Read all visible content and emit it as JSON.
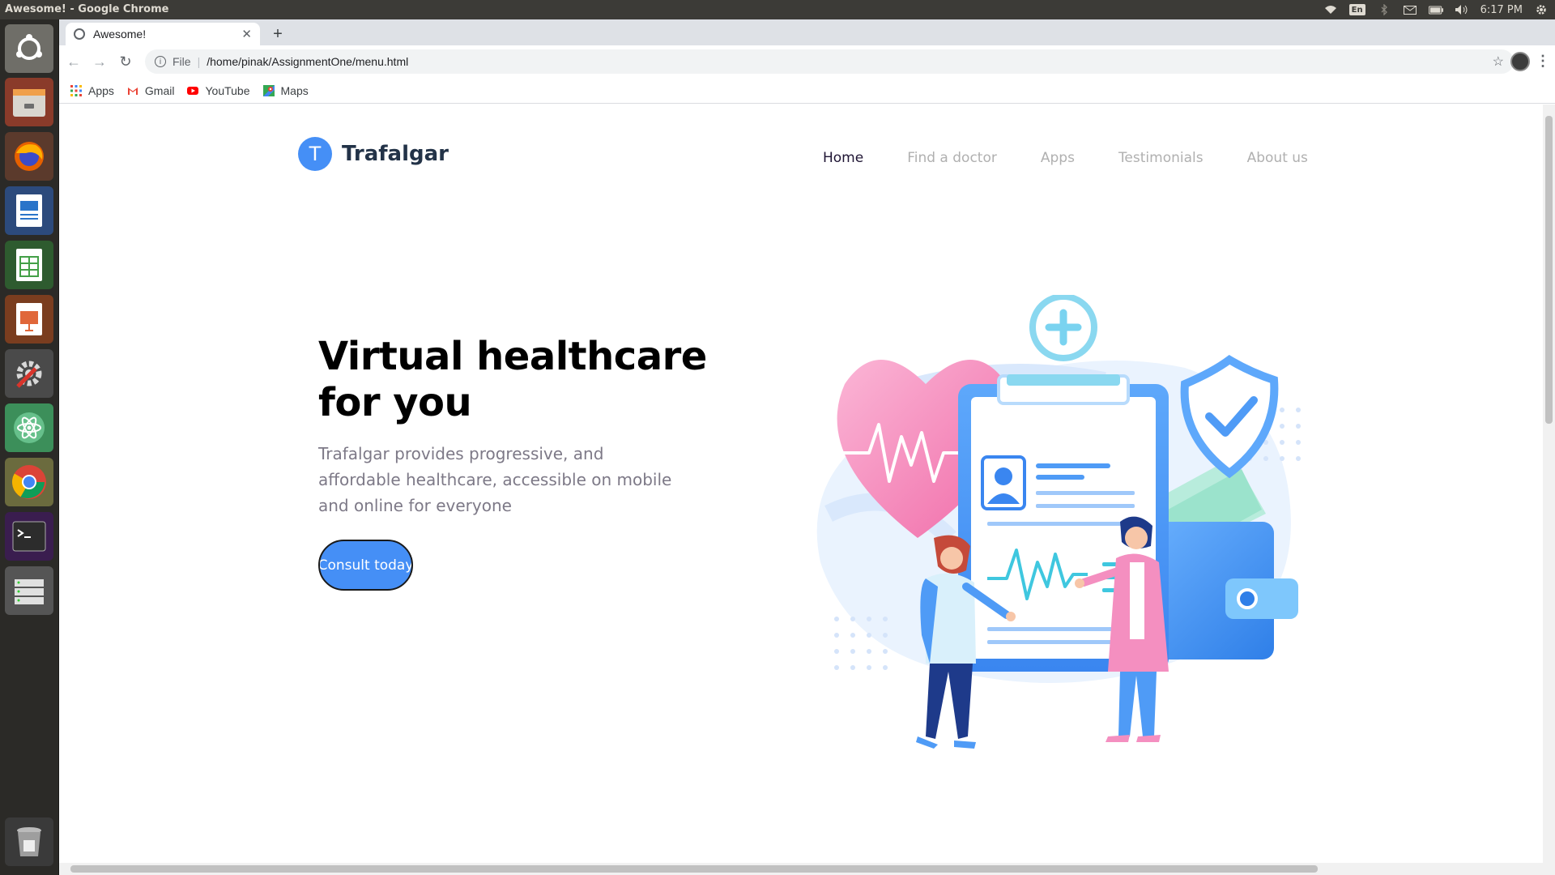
{
  "os": {
    "window_title": "Awesome! - Google Chrome",
    "keyboard_layout": "En",
    "clock": "6:17 PM",
    "tray_icons": [
      "wifi-icon",
      "bluetooth-icon",
      "mail-icon",
      "battery-icon",
      "volume-icon",
      "settings-icon"
    ],
    "launcher_apps": [
      "ubuntu-dash-icon",
      "files-icon",
      "firefox-icon",
      "writer-icon",
      "calc-icon",
      "impress-icon",
      "system-settings-icon",
      "atom-icon",
      "chrome-icon",
      "terminal-icon",
      "storage-icon",
      "trash-icon"
    ]
  },
  "browser": {
    "tab_title": "Awesome!",
    "url_scheme": "File",
    "url": "/home/pinak/AssignmentOne/menu.html",
    "bookmarks": [
      {
        "label": "Apps",
        "icon": "apps-grid-icon"
      },
      {
        "label": "Gmail",
        "icon": "gmail-icon"
      },
      {
        "label": "YouTube",
        "icon": "youtube-icon"
      },
      {
        "label": "Maps",
        "icon": "maps-icon"
      }
    ]
  },
  "site": {
    "logo_letter": "T",
    "brand": "Trafalgar",
    "nav": [
      "Home",
      "Find a doctor",
      "Apps",
      "Testimonials",
      "About us"
    ],
    "hero": {
      "title": "Virtual healthcare for you",
      "description": "Trafalgar provides progressive, and affordable healthcare, accessible on mobile and online for everyone",
      "cta": "Consult today"
    },
    "colors": {
      "primary": "#458ff6",
      "heading": "#000000",
      "body_text": "#7d7987",
      "nav_inactive": "#b0b0b0",
      "nav_active": "#1f1534"
    }
  }
}
